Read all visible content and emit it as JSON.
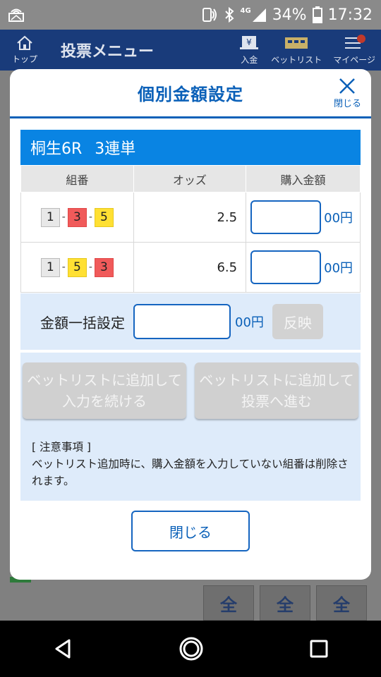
{
  "status_bar": {
    "network": "4G",
    "battery": "34%",
    "time": "17:32"
  },
  "app_header": {
    "home_label": "トップ",
    "title": "投票メニュー",
    "deposit_label": "入金",
    "betlist_label": "ベットリスト",
    "mypage_label": "マイページ"
  },
  "background": {
    "tabs": [
      "全",
      "全",
      "全"
    ]
  },
  "modal": {
    "title": "個別金額設定",
    "close_label": "閉じる",
    "race": {
      "venue_race": "桐生6R",
      "bet_type": "3連単"
    },
    "table": {
      "headers": [
        "組番",
        "オッズ",
        "購入金額"
      ],
      "rows": [
        {
          "combo": [
            "1",
            "3",
            "5"
          ],
          "odds": "2.5",
          "amount": "",
          "unit": "00円"
        },
        {
          "combo": [
            "1",
            "5",
            "3"
          ],
          "odds": "6.5",
          "amount": "",
          "unit": "00円"
        }
      ]
    },
    "bulk": {
      "label": "金額一括設定",
      "value": "",
      "unit": "00円",
      "reflect_label": "反映"
    },
    "actions": {
      "continue_line1": "ベットリストに追加して",
      "continue_line2": "入力を続ける",
      "proceed_line1": "ベットリストに追加して",
      "proceed_line2": "投票へ進む"
    },
    "notice": {
      "heading": "[ 注意事項 ]",
      "body": "ベットリスト追加時に、購入金額を入力していない組番は削除されます。"
    },
    "close_button": "閉じる"
  },
  "colors": {
    "primary": "#0a60b8",
    "race_bar": "#0984e3",
    "boat_1": "#e8e8e8",
    "boat_3": "#f05a5a",
    "boat_5": "#ffe033",
    "light_panel": "#deebfa"
  }
}
